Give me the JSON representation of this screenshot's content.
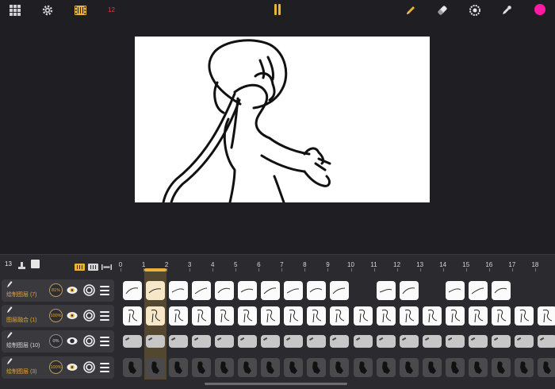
{
  "toolbar": {
    "left_icons": [
      "grid-icon",
      "gear-icon",
      "film-icon"
    ],
    "fps": "12",
    "right_icons": [
      "pencil-icon",
      "eraser-icon",
      "color-wheel-icon",
      "eyedropper-icon",
      "color-swatch"
    ],
    "accent": "#e9b339",
    "current_color": "#ff1aa3"
  },
  "timeline": {
    "frame_count": "13",
    "ruler": [
      "0",
      "1",
      "2",
      "3",
      "4",
      "5",
      "6",
      "7",
      "8",
      "9",
      "10",
      "11",
      "12",
      "13",
      "14",
      "15",
      "16",
      "17",
      "18",
      "1"
    ],
    "layers": [
      {
        "name": "绘制图层 (7)",
        "opacity": "81%",
        "active": true
      },
      {
        "name": "图层融合 (1)",
        "opacity": "100%",
        "active": true
      },
      {
        "name": "绘制图层 (10)",
        "opacity": "0%",
        "active": false
      },
      {
        "name": "绘制图层 (3)",
        "opacity": "100%",
        "active": true
      }
    ]
  }
}
